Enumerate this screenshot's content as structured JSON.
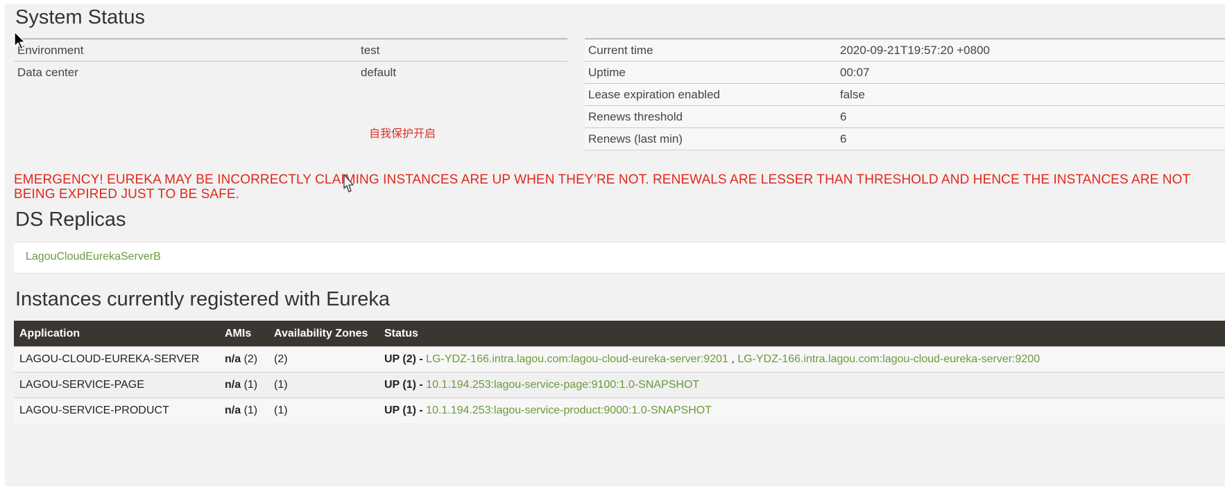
{
  "system_status": {
    "title": "System Status",
    "left": [
      {
        "key": "Environment",
        "value": "test"
      },
      {
        "key": "Data center",
        "value": "default"
      }
    ],
    "right": [
      {
        "key": "Current time",
        "value": "2020-09-21T19:57:20 +0800"
      },
      {
        "key": "Uptime",
        "value": "00:07"
      },
      {
        "key": "Lease expiration enabled",
        "value": "false"
      },
      {
        "key": "Renews threshold",
        "value": "6"
      },
      {
        "key": "Renews (last min)",
        "value": "6"
      }
    ],
    "self_preservation_note": "自我保护开启"
  },
  "emergency": "EMERGENCY! EUREKA MAY BE INCORRECTLY CLAIMING INSTANCES ARE UP WHEN THEY’RE NOT. RENEWALS ARE LESSER THAN THRESHOLD AND HENCE THE INSTANCES ARE NOT BEING EXPIRED JUST TO BE SAFE.",
  "replicas": {
    "title": "DS Replicas",
    "items": [
      "LagouCloudEurekaServerB"
    ]
  },
  "instances": {
    "title": "Instances currently registered with Eureka",
    "headers": [
      "Application",
      "AMIs",
      "Availability Zones",
      "Status"
    ],
    "rows": [
      {
        "application": "LAGOU-CLOUD-EUREKA-SERVER",
        "amis_na": "n/a",
        "amis_count": "(2)",
        "zones": "(2)",
        "status_up": "UP (2) -",
        "links": [
          "LG-YDZ-166.intra.lagou.com:lagou-cloud-eureka-server:9201",
          "LG-YDZ-166.intra.lagou.com:lagou-cloud-eureka-server:9200"
        ]
      },
      {
        "application": "LAGOU-SERVICE-PAGE",
        "amis_na": "n/a",
        "amis_count": "(1)",
        "zones": "(1)",
        "status_up": "UP (1) -",
        "links": [
          "10.1.194.253:lagou-service-page:9100:1.0-SNAPSHOT"
        ]
      },
      {
        "application": "LAGOU-SERVICE-PRODUCT",
        "amis_na": "n/a",
        "amis_count": "(1)",
        "zones": "(1)",
        "status_up": "UP (1) -",
        "links": [
          "10.1.194.253:lagou-service-product:9000:1.0-SNAPSHOT"
        ]
      }
    ]
  },
  "colors": {
    "emergency_red": "#e0281b",
    "link_green": "#6a9a3a",
    "table_header": "#3a3733"
  },
  "icons": [
    "mouse-pointer-arrow-icon",
    "text-cursor-hand-icon"
  ]
}
